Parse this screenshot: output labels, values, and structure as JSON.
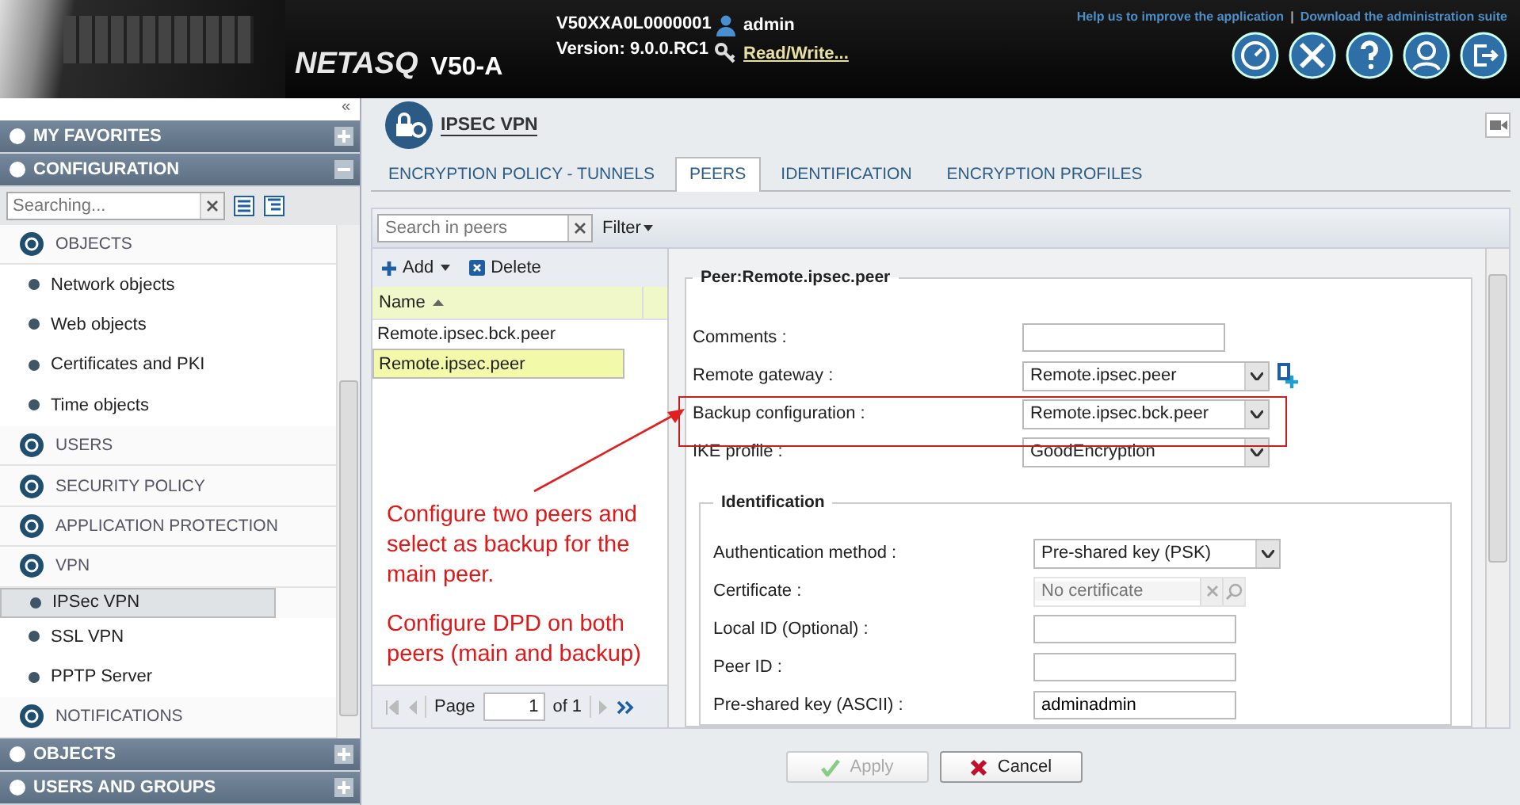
{
  "header": {
    "brand": "NETASQ",
    "model": "V50-A",
    "serial": "V50XXA0L0000001",
    "version": "Version: 9.0.0.RC1",
    "user": "admin",
    "access": "Read/Write...",
    "links": [
      "Help us to improve the application",
      "Download the administration suite"
    ],
    "link_separator": "|"
  },
  "sidebar": {
    "collapse": "«",
    "top_sections": [
      {
        "label": "MY FAVORITES",
        "expanded": false
      },
      {
        "label": "CONFIGURATION",
        "expanded": true
      }
    ],
    "search": {
      "placeholder": "Searching..."
    },
    "tree": [
      {
        "kind": "category",
        "label": "OBJECTS",
        "selected": false
      },
      {
        "kind": "item",
        "label": "Network objects",
        "selected": false
      },
      {
        "kind": "item",
        "label": "Web objects",
        "selected": false
      },
      {
        "kind": "item",
        "label": "Certificates and PKI",
        "selected": false
      },
      {
        "kind": "item",
        "label": "Time objects",
        "selected": false
      },
      {
        "kind": "category",
        "label": "USERS",
        "selected": false
      },
      {
        "kind": "category",
        "label": "SECURITY POLICY",
        "selected": false
      },
      {
        "kind": "category",
        "label": "APPLICATION PROTECTION",
        "selected": false
      },
      {
        "kind": "category",
        "label": "VPN",
        "selected": false
      },
      {
        "kind": "item",
        "label": "IPSec VPN",
        "selected": true
      },
      {
        "kind": "item",
        "label": "SSL VPN",
        "selected": false
      },
      {
        "kind": "item",
        "label": "PPTP Server",
        "selected": false
      },
      {
        "kind": "category",
        "label": "NOTIFICATIONS",
        "selected": false
      }
    ],
    "bottom_sections": [
      {
        "label": "OBJECTS",
        "expanded": false
      },
      {
        "label": "USERS AND GROUPS",
        "expanded": false
      }
    ]
  },
  "module": {
    "title": "IPSEC VPN"
  },
  "tabs": [
    {
      "label": "ENCRYPTION POLICY - TUNNELS",
      "selected": false
    },
    {
      "label": "PEERS",
      "selected": true
    },
    {
      "label": "IDENTIFICATION",
      "selected": false
    },
    {
      "label": "ENCRYPTION PROFILES",
      "selected": false
    }
  ],
  "peer_search": {
    "placeholder": "Search in peers"
  },
  "filter": "Filter",
  "list": {
    "add": "Add",
    "delete": "Delete",
    "column": "Name",
    "rows": [
      {
        "name": "Remote.ipsec.bck.peer",
        "selected": false
      },
      {
        "name": "Remote.ipsec.peer",
        "selected": true
      }
    ],
    "pager": {
      "label": "Page",
      "page": "1",
      "of": "of 1"
    }
  },
  "form": {
    "legend": "Peer:Remote.ipsec.peer",
    "fields": [
      {
        "kind": "text",
        "label": "Comments :"
      },
      {
        "kind": "select",
        "label": "Remote gateway :",
        "value": "Remote.ipsec.peer",
        "add_button": true
      },
      {
        "kind": "select",
        "label": "Backup configuration :",
        "value": "Remote.ipsec.bck.peer"
      },
      {
        "kind": "select",
        "label": "IKE profile :",
        "value": "GoodEncryption"
      }
    ],
    "identification": {
      "legend": "Identification",
      "fields": [
        {
          "kind": "select",
          "label": "Authentication method :",
          "value": "Pre-shared key (PSK)"
        },
        {
          "kind": "picker",
          "label": "Certificate :",
          "placeholder": "No certificate",
          "disabled": true
        },
        {
          "kind": "text",
          "label": "Local ID (Optional) :"
        },
        {
          "kind": "text",
          "label": "Peer ID :"
        },
        {
          "kind": "text",
          "label": "Pre-shared key (ASCII) :",
          "value": "adminadmin"
        }
      ]
    }
  },
  "buttons": [
    {
      "kind": "apply",
      "label": "Apply",
      "disabled": true
    },
    {
      "kind": "cancel",
      "label": "Cancel",
      "disabled": false
    }
  ],
  "annotations": [
    "Configure two peers and select as backup for the main peer.",
    "Configure DPD on both peers (main and backup)"
  ]
}
